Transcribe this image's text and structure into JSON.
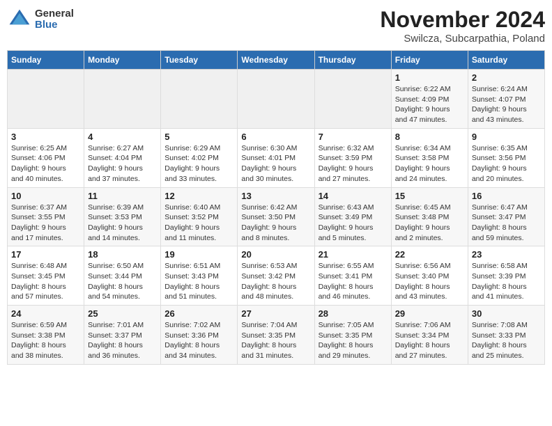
{
  "logo": {
    "general": "General",
    "blue": "Blue"
  },
  "title": "November 2024",
  "subtitle": "Swilcza, Subcarpathia, Poland",
  "days_of_week": [
    "Sunday",
    "Monday",
    "Tuesday",
    "Wednesday",
    "Thursday",
    "Friday",
    "Saturday"
  ],
  "weeks": [
    [
      {
        "day": "",
        "info": ""
      },
      {
        "day": "",
        "info": ""
      },
      {
        "day": "",
        "info": ""
      },
      {
        "day": "",
        "info": ""
      },
      {
        "day": "",
        "info": ""
      },
      {
        "day": "1",
        "info": "Sunrise: 6:22 AM\nSunset: 4:09 PM\nDaylight: 9 hours and 47 minutes."
      },
      {
        "day": "2",
        "info": "Sunrise: 6:24 AM\nSunset: 4:07 PM\nDaylight: 9 hours and 43 minutes."
      }
    ],
    [
      {
        "day": "3",
        "info": "Sunrise: 6:25 AM\nSunset: 4:06 PM\nDaylight: 9 hours and 40 minutes."
      },
      {
        "day": "4",
        "info": "Sunrise: 6:27 AM\nSunset: 4:04 PM\nDaylight: 9 hours and 37 minutes."
      },
      {
        "day": "5",
        "info": "Sunrise: 6:29 AM\nSunset: 4:02 PM\nDaylight: 9 hours and 33 minutes."
      },
      {
        "day": "6",
        "info": "Sunrise: 6:30 AM\nSunset: 4:01 PM\nDaylight: 9 hours and 30 minutes."
      },
      {
        "day": "7",
        "info": "Sunrise: 6:32 AM\nSunset: 3:59 PM\nDaylight: 9 hours and 27 minutes."
      },
      {
        "day": "8",
        "info": "Sunrise: 6:34 AM\nSunset: 3:58 PM\nDaylight: 9 hours and 24 minutes."
      },
      {
        "day": "9",
        "info": "Sunrise: 6:35 AM\nSunset: 3:56 PM\nDaylight: 9 hours and 20 minutes."
      }
    ],
    [
      {
        "day": "10",
        "info": "Sunrise: 6:37 AM\nSunset: 3:55 PM\nDaylight: 9 hours and 17 minutes."
      },
      {
        "day": "11",
        "info": "Sunrise: 6:39 AM\nSunset: 3:53 PM\nDaylight: 9 hours and 14 minutes."
      },
      {
        "day": "12",
        "info": "Sunrise: 6:40 AM\nSunset: 3:52 PM\nDaylight: 9 hours and 11 minutes."
      },
      {
        "day": "13",
        "info": "Sunrise: 6:42 AM\nSunset: 3:50 PM\nDaylight: 9 hours and 8 minutes."
      },
      {
        "day": "14",
        "info": "Sunrise: 6:43 AM\nSunset: 3:49 PM\nDaylight: 9 hours and 5 minutes."
      },
      {
        "day": "15",
        "info": "Sunrise: 6:45 AM\nSunset: 3:48 PM\nDaylight: 9 hours and 2 minutes."
      },
      {
        "day": "16",
        "info": "Sunrise: 6:47 AM\nSunset: 3:47 PM\nDaylight: 8 hours and 59 minutes."
      }
    ],
    [
      {
        "day": "17",
        "info": "Sunrise: 6:48 AM\nSunset: 3:45 PM\nDaylight: 8 hours and 57 minutes."
      },
      {
        "day": "18",
        "info": "Sunrise: 6:50 AM\nSunset: 3:44 PM\nDaylight: 8 hours and 54 minutes."
      },
      {
        "day": "19",
        "info": "Sunrise: 6:51 AM\nSunset: 3:43 PM\nDaylight: 8 hours and 51 minutes."
      },
      {
        "day": "20",
        "info": "Sunrise: 6:53 AM\nSunset: 3:42 PM\nDaylight: 8 hours and 48 minutes."
      },
      {
        "day": "21",
        "info": "Sunrise: 6:55 AM\nSunset: 3:41 PM\nDaylight: 8 hours and 46 minutes."
      },
      {
        "day": "22",
        "info": "Sunrise: 6:56 AM\nSunset: 3:40 PM\nDaylight: 8 hours and 43 minutes."
      },
      {
        "day": "23",
        "info": "Sunrise: 6:58 AM\nSunset: 3:39 PM\nDaylight: 8 hours and 41 minutes."
      }
    ],
    [
      {
        "day": "24",
        "info": "Sunrise: 6:59 AM\nSunset: 3:38 PM\nDaylight: 8 hours and 38 minutes."
      },
      {
        "day": "25",
        "info": "Sunrise: 7:01 AM\nSunset: 3:37 PM\nDaylight: 8 hours and 36 minutes."
      },
      {
        "day": "26",
        "info": "Sunrise: 7:02 AM\nSunset: 3:36 PM\nDaylight: 8 hours and 34 minutes."
      },
      {
        "day": "27",
        "info": "Sunrise: 7:04 AM\nSunset: 3:35 PM\nDaylight: 8 hours and 31 minutes."
      },
      {
        "day": "28",
        "info": "Sunrise: 7:05 AM\nSunset: 3:35 PM\nDaylight: 8 hours and 29 minutes."
      },
      {
        "day": "29",
        "info": "Sunrise: 7:06 AM\nSunset: 3:34 PM\nDaylight: 8 hours and 27 minutes."
      },
      {
        "day": "30",
        "info": "Sunrise: 7:08 AM\nSunset: 3:33 PM\nDaylight: 8 hours and 25 minutes."
      }
    ]
  ]
}
